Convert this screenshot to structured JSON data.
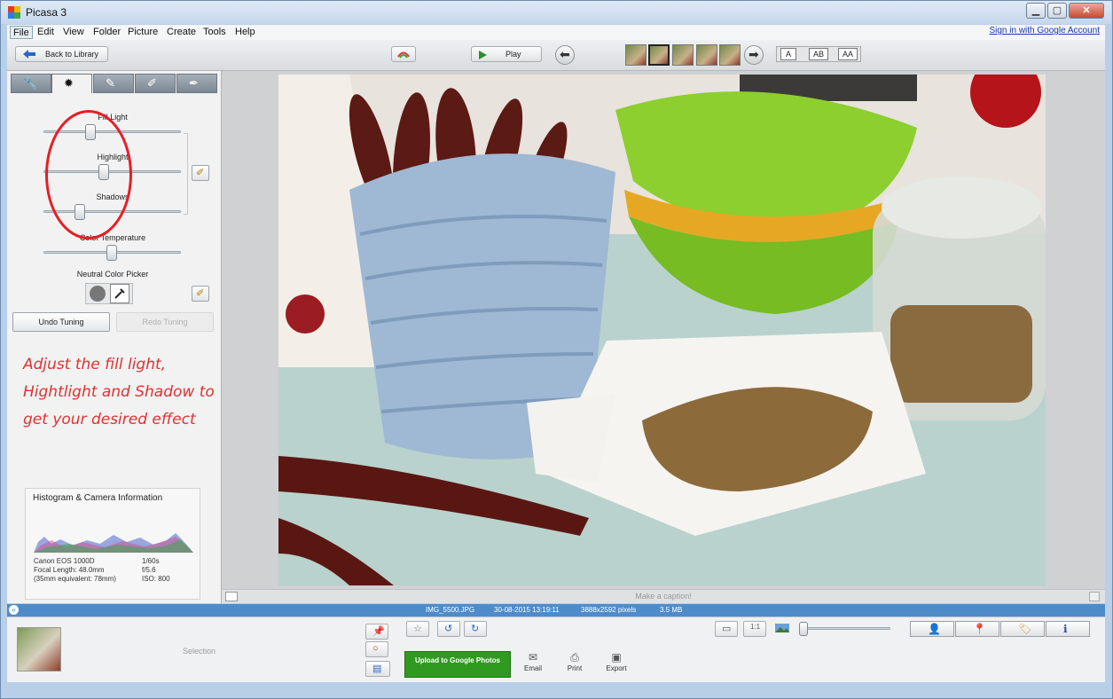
{
  "window": {
    "title": "Picasa 3",
    "min": "▁",
    "max": "▢",
    "close": "✕"
  },
  "menu": [
    "File",
    "Edit",
    "View",
    "Folder",
    "Picture",
    "Create",
    "Tools",
    "Help"
  ],
  "sign_in": "Sign in with Google Account",
  "toolbar": {
    "back": "Back to Library",
    "play": "Play",
    "caption_buttons": [
      "A",
      "AB",
      "AA"
    ]
  },
  "tuning": {
    "sliders": [
      {
        "label": "Fill Light",
        "level": 0.2
      },
      {
        "label": "Highlight",
        "level": 0.4
      },
      {
        "label": "Shadows",
        "level": 0.25
      },
      {
        "label": "Color Temperature",
        "level": 0.5
      }
    ],
    "neutral_picker": "Neutral Color Picker",
    "undo": "Undo Tuning",
    "redo": "Redo Tuning"
  },
  "annotation": "Adjust the fill light, Hightlight and Shadow to get your desired effect",
  "histogram": {
    "title": "Histogram & Camera Information",
    "camera": "Canon EOS 1000D",
    "focal": "Focal Length: 48.0mm",
    "equiv": "(35mm equivalent:  78mm)",
    "shutter": "1/60s",
    "aperture": "f/5.6",
    "iso": "ISO: 800"
  },
  "caption_placeholder": "Make a caption!",
  "info": {
    "filename": "IMG_5500.JPG",
    "date": "30-08-2015 13:19:11",
    "dims": "3888x2592 pixels",
    "size": "3.5 MB"
  },
  "tray": {
    "selection": "Selection",
    "upload": "Upload to Google Photos",
    "email": "Email",
    "print": "Print",
    "export": "Export"
  },
  "colors": {
    "annotation": "#e03131",
    "accent": "#4e8cc9",
    "upload": "#2f9a1f"
  }
}
